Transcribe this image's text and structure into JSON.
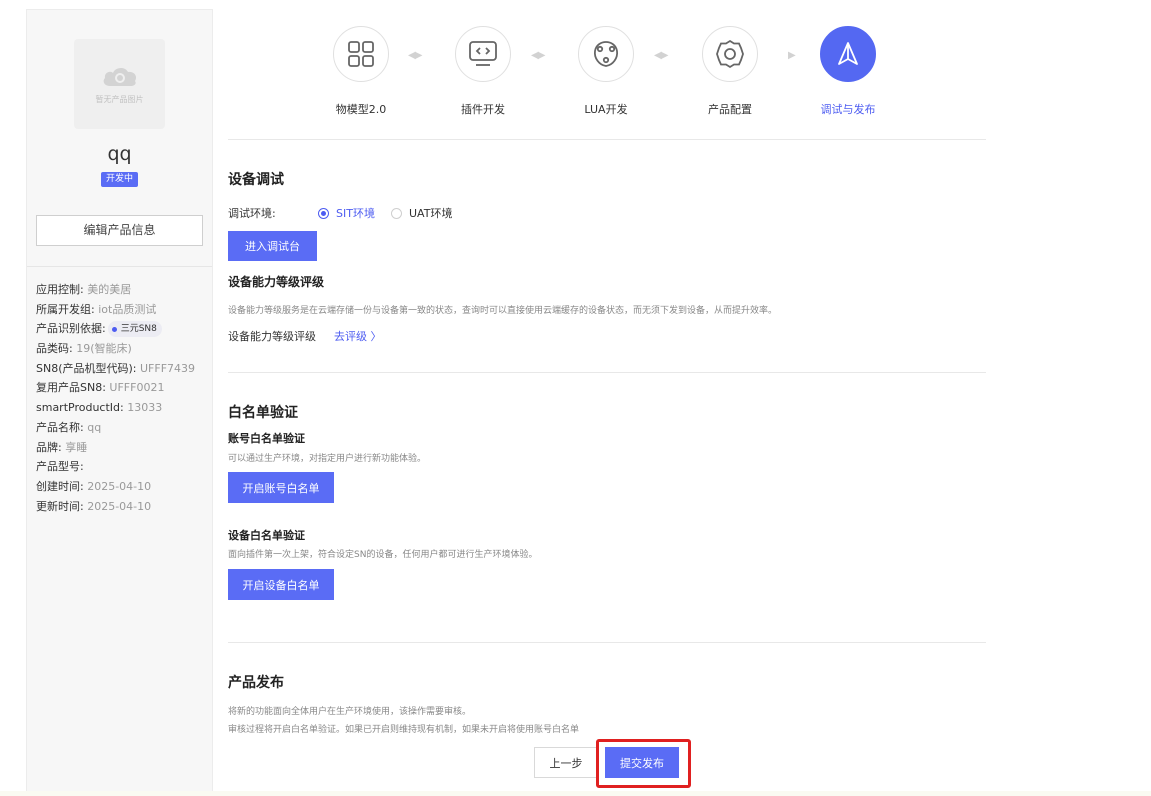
{
  "sidebar": {
    "thumbnail_text": "暂无产品图片",
    "product_name": "qq",
    "status_badge": "开发中",
    "edit_button": "编辑产品信息",
    "info": [
      {
        "label": "应用控制:",
        "value": "美的美居"
      },
      {
        "label": "所属开发组:",
        "value": "iot品质测试"
      },
      {
        "label": "产品识别依据:",
        "chip": "三元SN8"
      },
      {
        "label": "品类码:",
        "value": "19(智能床)"
      },
      {
        "label": "SN8(产品机型代码):",
        "value": "UFFF7439"
      },
      {
        "label": "复用产品SN8:",
        "value": "UFFF0021"
      },
      {
        "label": "smartProductId:",
        "value": "13033"
      },
      {
        "label": "产品名称:",
        "value": "qq"
      },
      {
        "label": "品牌:",
        "value": "享睡"
      },
      {
        "label": "产品型号:",
        "value": ""
      },
      {
        "label": "创建时间:",
        "value": "2025-04-10"
      },
      {
        "label": "更新时间:",
        "value": "2025-04-10"
      }
    ]
  },
  "steps": [
    {
      "label": "物模型2.0",
      "icon": "grid-icon",
      "active": false
    },
    {
      "label": "插件开发",
      "icon": "code-monitor-icon",
      "active": false
    },
    {
      "label": "LUA开发",
      "icon": "network-shield-icon",
      "active": false
    },
    {
      "label": "产品配置",
      "icon": "gear-icon",
      "active": false
    },
    {
      "label": "调试与发布",
      "icon": "send-icon",
      "active": true
    }
  ],
  "debug": {
    "title": "设备调试",
    "env_label": "调试环境:",
    "env_options": [
      {
        "label": "SIT环境",
        "selected": true
      },
      {
        "label": "UAT环境",
        "selected": false
      }
    ],
    "enter_button": "进入调试台"
  },
  "rating": {
    "title": "设备能力等级评级",
    "desc": "设备能力等级服务是在云端存储一份与设备第一致的状态，查询时可以直接使用云端缓存的设备状态，而无须下发到设备，从而提升效率。",
    "row_label": "设备能力等级评级",
    "link": "去评级 〉"
  },
  "whitelist": {
    "title": "白名单验证",
    "account": {
      "title": "账号白名单验证",
      "desc": "可以通过生产环境，对指定用户进行新功能体验。",
      "button": "开启账号白名单"
    },
    "device": {
      "title": "设备白名单验证",
      "desc": "面向插件第一次上架，符合设定SN的设备，任何用户都可进行生产环境体验。",
      "button": "开启设备白名单"
    }
  },
  "publish": {
    "title": "产品发布",
    "desc1": "将新的功能面向全体用户在生产环境使用，该操作需要审核。",
    "desc2": "审核过程将开启白名单验证。如果已开启则维持现有机制，如果未开启将使用账号白名单",
    "prev_button": "上一步",
    "submit_button": "提交发布"
  },
  "colors": {
    "accent": "#5a6cf5",
    "highlight": "#e02020"
  }
}
